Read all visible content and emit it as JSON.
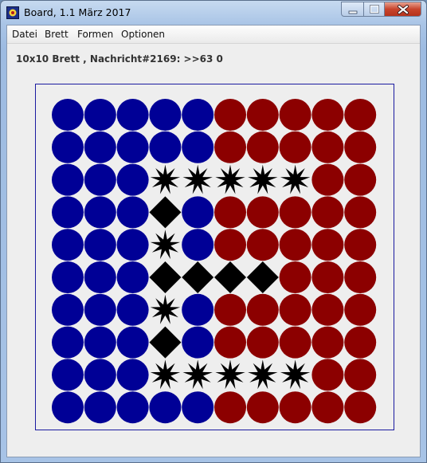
{
  "window": {
    "title": "Board, 1.1 März 2017"
  },
  "menu": [
    "Datei",
    "Brett",
    "Formen",
    "Optionen"
  ],
  "status": {
    "message": "10x10 Brett , Nachricht#2169: >>63 0"
  },
  "board": {
    "size": 10,
    "colors": {
      "blue": "#000096",
      "red": "#8c0000",
      "black": "#000000"
    },
    "cells": [
      "BBBBBRRRRR",
      "BBBBBRRRRR",
      "BBBSSSSSRR",
      "BBBDBRRRRR",
      "BBBSBRRRRR",
      "BBBDDDDRRR",
      "BBBSBRRRRR",
      "BBBDBRRRRR",
      "BBBSSSSSRR",
      "BBBBBRRRRR"
    ],
    "legend": {
      "B": "blue-circle",
      "R": "red-circle",
      "S": "black-star",
      "D": "black-diamond"
    }
  }
}
